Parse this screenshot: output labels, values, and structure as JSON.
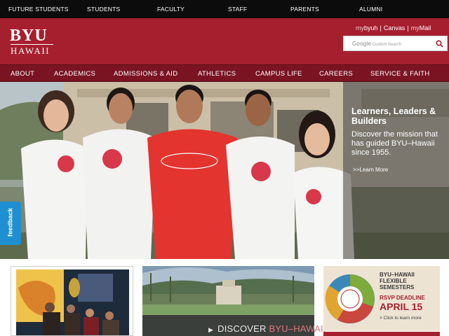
{
  "audience_bar": {
    "links": [
      "FUTURE STUDENTS",
      "STUDENTS",
      "FACULTY",
      "STAFF",
      "PARENTS",
      "ALUMNI"
    ]
  },
  "header": {
    "logo_top": "BYU",
    "logo_bottom": "HAWAII",
    "quick_links": {
      "mybyuh_prefix": "my",
      "mybyuh_main": "byuh",
      "canvas": "Canvas",
      "mymail_prefix": "my",
      "mymail_main": "Mail",
      "separator": "|"
    },
    "search": {
      "brand": "Google",
      "placeholder": "Custom Search",
      "button_icon": "search-icon"
    }
  },
  "nav": {
    "items": [
      "ABOUT",
      "ACADEMICS",
      "ADMISSIONS & AID",
      "ATHLETICS",
      "CAMPUS LIFE",
      "CAREERS",
      "SERVICE & FAITH"
    ]
  },
  "hero": {
    "title": "Learners, Leaders & Builders",
    "text": "Discover the mission that has guided BYU–Hawaii since 1955.",
    "more_link": ">>Learn More"
  },
  "feedback": {
    "label": "feedback"
  },
  "promos": {
    "discover": {
      "play_icon": "▶",
      "word": "DISCOVER ",
      "accent": "BYU–HAWAII"
    },
    "semesters": {
      "title": "BYU–HAWAII FLEXIBLE SEMESTERS",
      "rsvp": "RSVP DEADLINE",
      "date": "APRIL 15",
      "click": "> Click to learn more"
    }
  },
  "colors": {
    "brand_red": "#a61f2e",
    "nav_red": "#7a1423",
    "top_bar": "#0c0c0c",
    "feedback_blue": "#1e8fd0"
  }
}
